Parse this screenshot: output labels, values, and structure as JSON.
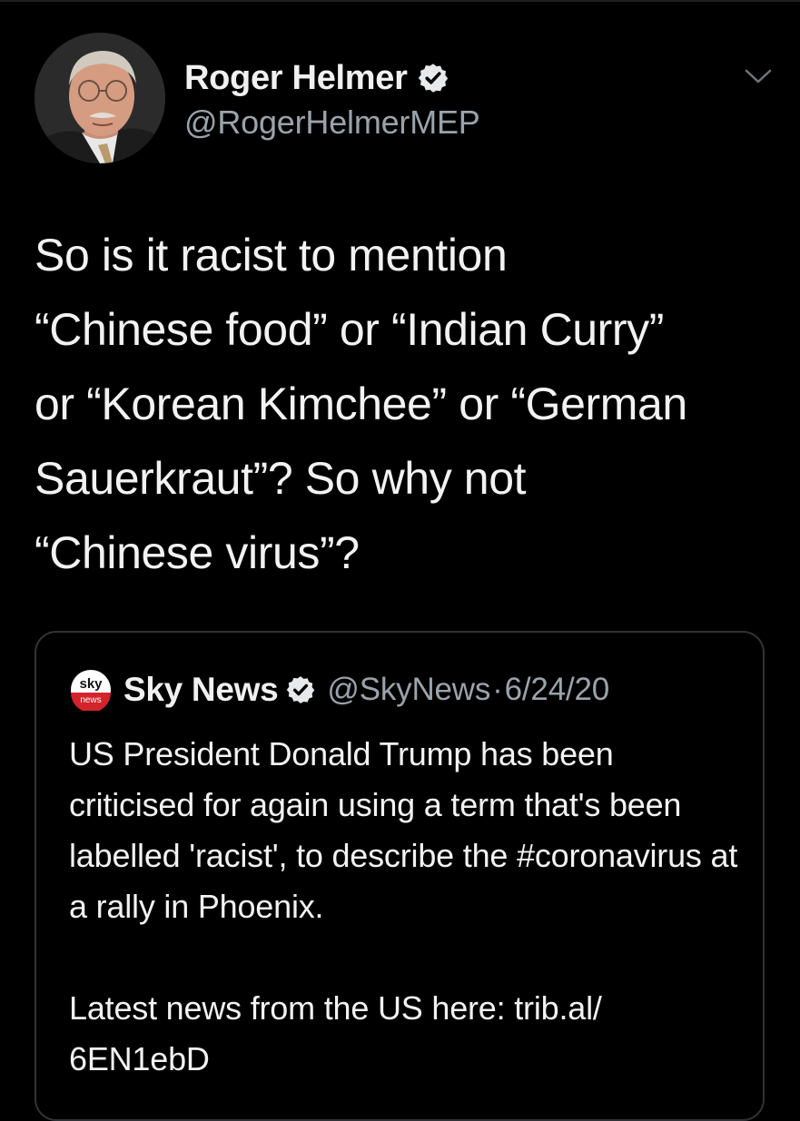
{
  "author": {
    "display_name": "Roger Helmer",
    "handle": "@RogerHelmerMEP",
    "verified": true,
    "avatar_icon": "profile-photo"
  },
  "tweet": {
    "text": "So is it racist to mention\n“Chinese food” or “Indian Curry”\nor “Korean Kimchee” or “German\nSauerkraut”? So why not\n“Chinese virus”?"
  },
  "menu": {
    "icon": "chevron-down-icon"
  },
  "quoted_tweet": {
    "logo_text_top": "sky",
    "logo_text_bottom": "news",
    "display_name": "Sky News",
    "verified": true,
    "handle": "@SkyNews",
    "separator": "·",
    "date": "6/24/20",
    "paragraph_1": "US President Donald Trump has been criticised for again using a term that's been labelled 'racist', to describe the #coronavirus at a rally in Phoenix.",
    "paragraph_2": "Latest news from the US here: trib.al/ 6EN1ebD"
  },
  "colors": {
    "background": "#000000",
    "text_primary": "#f2f2f2",
    "text_secondary": "#9aa3ab",
    "border": "#2f3336",
    "sky_red": "#d3242c"
  }
}
